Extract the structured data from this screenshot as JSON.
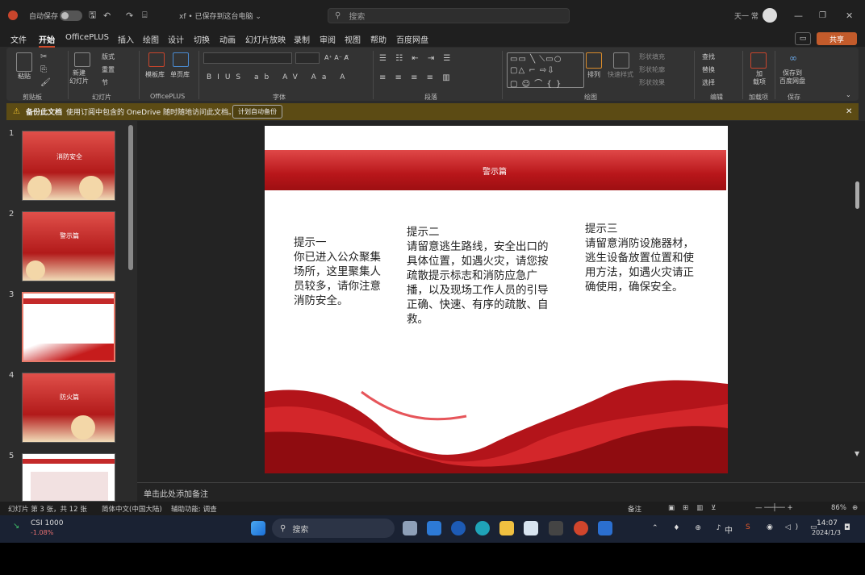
{
  "titlebar": {
    "autosave": "自动保存",
    "filename": "xf • 已保存到这台电脑 ⌄",
    "search_placeholder": "搜索",
    "user": "天一 常"
  },
  "menu": [
    "文件",
    "开始",
    "OfficePLUS",
    "插入",
    "绘图",
    "设计",
    "切换",
    "动画",
    "幻灯片放映",
    "录制",
    "审阅",
    "视图",
    "帮助",
    "百度网盘"
  ],
  "share_label": "共享",
  "ribbon": {
    "paste": "粘贴",
    "new_slide": "新建\n幻灯片",
    "layout": "版式",
    "reset": "重置",
    "section": "节",
    "template_lib": "模板库",
    "single_lib": "单页库",
    "arrange": "排列",
    "quick_style": "快速样式",
    "shape_fill": "形状填充",
    "shape_outline": "形状轮廓",
    "shape_effect": "形状效果",
    "find": "查找",
    "replace": "替换",
    "select": "选择",
    "addin": "加\n载项",
    "save_baidu": "保存到\n百度网盘",
    "groups": [
      "剪贴板",
      "幻灯片",
      "OfficePLUS",
      "字体",
      "段落",
      "绘图",
      "编辑",
      "加载项",
      "保存"
    ]
  },
  "warning": {
    "title": "备份此文档",
    "message": "使用订阅中包含的 OneDrive 随时随地访问此文档。",
    "button": "计划自动备份"
  },
  "thumbnails": [
    {
      "num": "1",
      "title": "消防安全"
    },
    {
      "num": "2",
      "title": "警示篇"
    },
    {
      "num": "3",
      "title": ""
    },
    {
      "num": "4",
      "title": "防火篇"
    },
    {
      "num": "5",
      "title": ""
    }
  ],
  "slide": {
    "banner_title": "警示篇",
    "col1": "提示一\n你已进入公众聚集场所，这里聚集人员较多，请你注意消防安全。",
    "col2": "提示二\n请留意逃生路线，安全出口的具体位置，如遇火灾，请您按疏散提示标志和消防应急广播，以及现场工作人员的引导正确、快速、有序的疏散、自救。",
    "col3": "提示三\n请留意消防设施器材，逃生设备放置位置和使用方法，如遇火灾请正确使用，确保安全。"
  },
  "notes_placeholder": "单击此处添加备注",
  "status": {
    "slide_info": "幻灯片 第 3 张，共 12 张",
    "language": "简体中文(中国大陆)",
    "accessibility": "辅助功能: 调查",
    "notes": "备注",
    "zoom": "86%"
  },
  "taskbar": {
    "stock_name": "CSI 1000",
    "stock_change": "-1.08%",
    "search": "搜索",
    "time": "14:07",
    "date": "2024/1/3",
    "ime": "中"
  },
  "colors": {
    "accent": "#c35b2b",
    "slide_red": "#b8161a",
    "warn": "#5c4b14"
  }
}
